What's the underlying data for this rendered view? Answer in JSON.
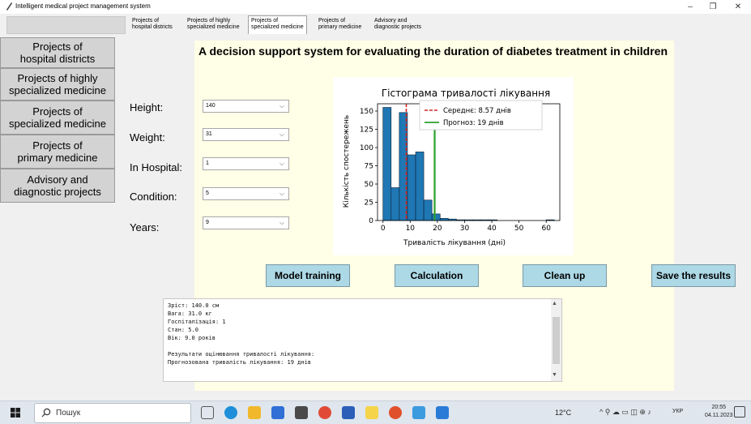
{
  "window": {
    "title": "Intelligent medical project management system"
  },
  "tabs": [
    {
      "label": "Projects of hospital districts",
      "line1": "Projects of",
      "line2": "hospital districts"
    },
    {
      "label": "Projects of highly specialized medicine",
      "line1": "Projects of highly",
      "line2": "specialized medicine"
    },
    {
      "label": "Projects of specialized medicine",
      "line1": "Projects of",
      "line2": "specialized medicine",
      "active": true
    },
    {
      "label": "Projects of primary medicine",
      "line1": "Projects of",
      "line2": "primary medicine"
    },
    {
      "label": "Advisory and diagnostic projects",
      "line1": "Advisory and",
      "line2": "diagnostic projects"
    }
  ],
  "sidebar": {
    "items": [
      {
        "line1": "Projects of",
        "line2": "hospital districts"
      },
      {
        "line1": "Projects of highly",
        "line2": "specialized medicine"
      },
      {
        "line1": "Projects of",
        "line2": "specialized medicine"
      },
      {
        "line1": "Projects of",
        "line2": "primary medicine"
      },
      {
        "line1": "Advisory and",
        "line2": "diagnostic projects"
      }
    ]
  },
  "main": {
    "title": "A decision support system for evaluating the duration of diabetes treatment in children",
    "fields": [
      {
        "label": "Height:",
        "value": "140"
      },
      {
        "label": "Weight:",
        "value": "31"
      },
      {
        "label": "In Hospital:",
        "value": "1"
      },
      {
        "label": "Condition:",
        "value": "5"
      },
      {
        "label": "Years:",
        "value": "9"
      }
    ],
    "buttons": {
      "train": "Model training",
      "calc": "Calculation",
      "clear": "Clean up",
      "save": "Save the results"
    },
    "output_lines": [
      "Зріст: 140.0 см",
      "Вага: 31.0 кг",
      "Госпіталізація: 1",
      "Стан: 5.0",
      "Вік: 9.0 років",
      "",
      "Результати оцінювання тривалості лікування:",
      "Прогнозована тривалість лікування: 19 днів"
    ]
  },
  "chart_data": {
    "type": "bar",
    "title": "Гістограма тривалості лікування",
    "xlabel": "Тривалість лікування (дні)",
    "ylabel": "Кількість спостережень",
    "xlim": [
      -2,
      65
    ],
    "ylim": [
      0,
      160
    ],
    "xticks": [
      0,
      10,
      20,
      30,
      40,
      50,
      60
    ],
    "yticks": [
      0,
      25,
      50,
      75,
      100,
      125,
      150
    ],
    "bar_color": "#1f77b4",
    "bins": [
      {
        "x0": 0,
        "x1": 3,
        "count": 155
      },
      {
        "x0": 3,
        "x1": 6,
        "count": 45
      },
      {
        "x0": 6,
        "x1": 9,
        "count": 148
      },
      {
        "x0": 9,
        "x1": 12,
        "count": 90
      },
      {
        "x0": 12,
        "x1": 15,
        "count": 94
      },
      {
        "x0": 15,
        "x1": 18,
        "count": 28
      },
      {
        "x0": 18,
        "x1": 21,
        "count": 9
      },
      {
        "x0": 21,
        "x1": 24,
        "count": 3
      },
      {
        "x0": 24,
        "x1": 27,
        "count": 2
      },
      {
        "x0": 27,
        "x1": 30,
        "count": 1
      },
      {
        "x0": 30,
        "x1": 33,
        "count": 1
      },
      {
        "x0": 33,
        "x1": 36,
        "count": 1
      },
      {
        "x0": 36,
        "x1": 39,
        "count": 1
      },
      {
        "x0": 39,
        "x1": 42,
        "count": 1
      },
      {
        "x0": 60,
        "x1": 63,
        "count": 1
      }
    ],
    "lines": [
      {
        "name": "Середнє: 8.57 днів",
        "x": 8.57,
        "color": "#d62728",
        "style": "dashed"
      },
      {
        "name": "Прогноз: 19 днів",
        "x": 19,
        "color": "#2ca02c",
        "style": "solid"
      }
    ],
    "legend": "top-right"
  },
  "taskbar": {
    "search_placeholder": "Пошук",
    "weather": "12°C",
    "language": "УКР",
    "time": "20:55",
    "date": "04.11.2023"
  }
}
